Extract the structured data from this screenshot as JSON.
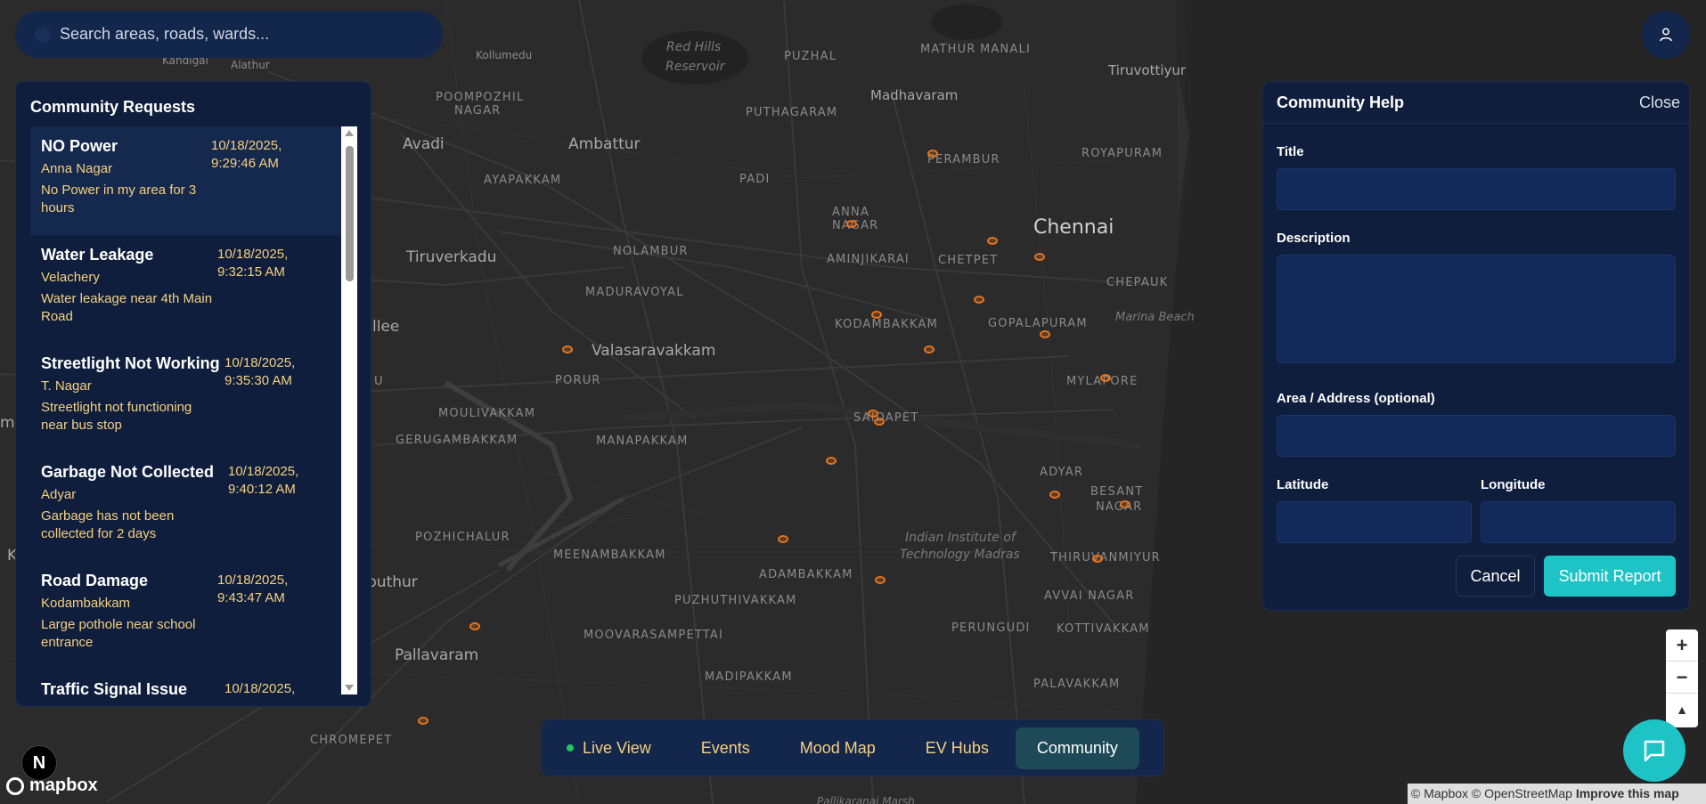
{
  "search": {
    "placeholder": "Search areas, roads, wards..."
  },
  "map": {
    "labels": {
      "kollumedu": "Kollumedu",
      "red_hills": "Red Hills",
      "reservoir": "Reservoir",
      "puzhal": "PUZHAL",
      "mathur": "MATHUR",
      "manali": "MANALI",
      "tiruvottiyur": "Tiruvottiyur",
      "kandigai": "Kandigai",
      "alathur": "Alathur",
      "poompozhil": "POOMPOZHIL",
      "nagar": "NAGAR",
      "madhavaram": "Madhavaram",
      "puthagaram": "PUTHAGARAM",
      "avadi": "Avadi",
      "ambattur": "Ambattur",
      "perambur": "PERAMBUR",
      "royapuram": "ROYAPURAM",
      "ayapakkam": "AYAPAKKAM",
      "padi": "PADI",
      "anna": "ANNA",
      "anna_nagar": "NAGAR",
      "chennai": "Chennai",
      "tiruverkadu": "Tiruverkadu",
      "nolambur": "NOLAMBUR",
      "aminjikarai": "AMINJIKARAI",
      "chetpet": "CHETPET",
      "chepauk": "CHEPAUK",
      "maduravoyal": "MADURAVOYAL",
      "kodambakkam": "KODAMBAKKAM",
      "gopalapuram": "GOPALAPURAM",
      "marina": "Marina Beach",
      "llee": "llee",
      "valasaravakkam": "Valasaravakkam",
      "porur": "PORUR",
      "mylapore": "MYLAPORE",
      "u": "U",
      "moulivakkam": "MOULIVAKKAM",
      "saidapet": "SAIDAPET",
      "gerugambakkam": "GERUGAMBAKKAM",
      "manapakkam": "MANAPAKKAM",
      "adyar": "ADYAR",
      "besant": "BESANT",
      "besant_nagar": "NAGAR",
      "iit1": "Indian Institute of",
      "iit2": "Technology Madras",
      "pozhichalur": "POZHICHALUR",
      "meenambakkam": "MEENAMBAKKAM",
      "adambakkam": "ADAMBAKKAM",
      "thiruvanmiyur": "THIRUVANMIYUR",
      "puthur": "puthur",
      "puzhuthivakkam": "PUZHUTHIVAKKAM",
      "avvai": "AVVAI NAGAR",
      "moovarasampettai": "MOOVARASAMPETTAI",
      "perungudi": "PERUNGUDI",
      "kottivakkam": "KOTTIVAKKAM",
      "pallavaram": "Pallavaram",
      "madipakkam": "MADIPAKKAM",
      "palavakkam": "PALAVAKKAM",
      "chromepet": "CHROMEPET",
      "pallikaranai": "Pallikaranai Marsh",
      "k": "K",
      "mb": "mb"
    }
  },
  "requests": {
    "title": "Community Requests",
    "items": [
      {
        "title": "NO Power",
        "area": "Anna Nagar",
        "desc": "No Power in my area for 3 hours",
        "time": "10/18/2025, 9:29:46 AM"
      },
      {
        "title": "Water Leakage",
        "area": "Velachery",
        "desc": "Water leakage near 4th Main Road",
        "time": "10/18/2025, 9:32:15 AM"
      },
      {
        "title": "Streetlight Not Working",
        "area": "T. Nagar",
        "desc": "Streetlight not functioning near bus stop",
        "time": "10/18/2025, 9:35:30 AM"
      },
      {
        "title": "Garbage Not Collected",
        "area": "Adyar",
        "desc": "Garbage has not been collected for 2 days",
        "time": "10/18/2025, 9:40:12 AM"
      },
      {
        "title": "Road Damage",
        "area": "Kodambakkam",
        "desc": "Large pothole near school entrance",
        "time": "10/18/2025, 9:43:47 AM"
      },
      {
        "title": "Traffic Signal Issue",
        "area": "",
        "desc": "",
        "time": "10/18/2025,"
      }
    ]
  },
  "help": {
    "title": "Community Help",
    "close": "Close",
    "title_label": "Title",
    "desc_label": "Description",
    "area_label": "Area / Address (optional)",
    "lat_label": "Latitude",
    "lng_label": "Longitude",
    "cancel": "Cancel",
    "submit": "Submit Report"
  },
  "nav": {
    "tabs": [
      "Live View",
      "Events",
      "Mood Map",
      "EV Hubs",
      "Community"
    ],
    "active": "Community"
  },
  "attribution": {
    "text": "© Mapbox © OpenStreetMap",
    "improve": "Improve this map"
  },
  "logo": {
    "brand": "mapbox",
    "badge": "N"
  },
  "colors": {
    "accent": "#1ec3c6",
    "panel": "#0f1e3c",
    "marker": "#e8731d",
    "area_text": "#f5d080"
  }
}
